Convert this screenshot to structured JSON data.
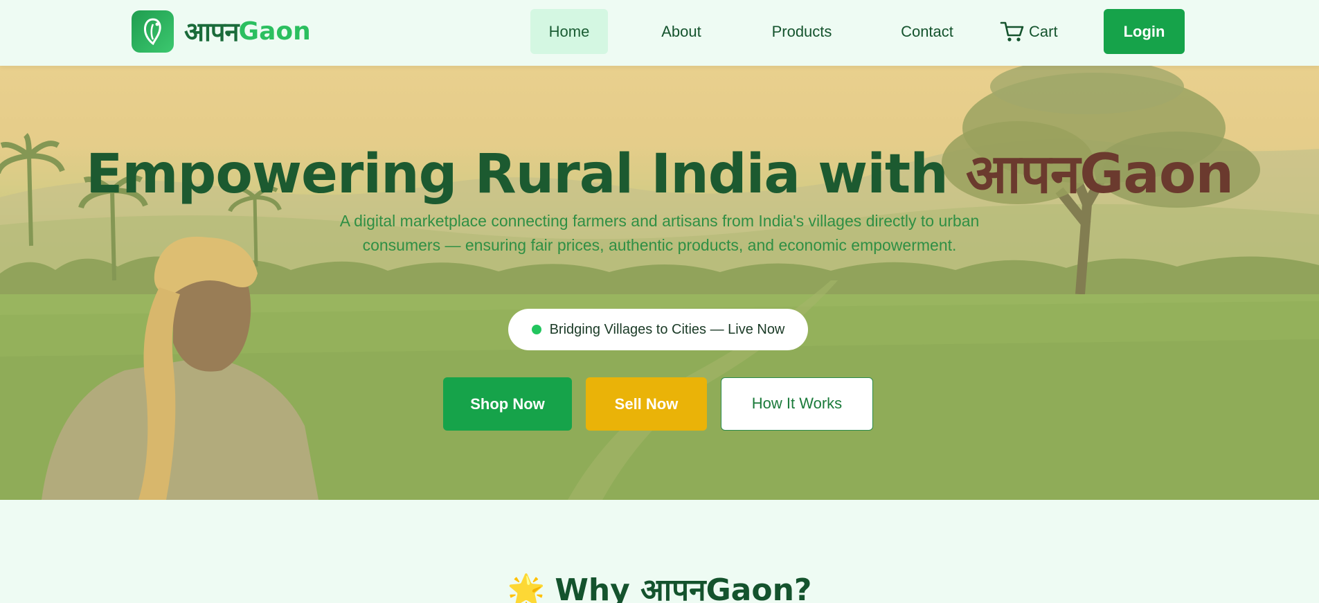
{
  "brand": {
    "hindi": "आपन",
    "latin": "Gaon"
  },
  "nav": {
    "items": [
      "Home",
      "About",
      "Products",
      "Contact"
    ],
    "cart_label": "Cart",
    "login_label": "Login"
  },
  "hero": {
    "title_main": "Empowering Rural India with ",
    "title_accent": "आपनGaon",
    "subtitle": "A digital marketplace connecting farmers and artisans from India's villages directly to urban consumers — ensuring fair prices, authentic products, and economic empowerment.",
    "live_badge": "Bridging Villages to Cities — Live Now",
    "buttons": {
      "shop": "Shop Now",
      "sell": "Sell Now",
      "how": "How It Works"
    }
  },
  "why": {
    "star": "🌟",
    "title": "Why आपनGaon?"
  },
  "colors": {
    "primary_green": "#16a34a",
    "dark_green": "#14532d",
    "accent_yellow": "#eab308",
    "accent_brown": "#6b3a2e",
    "background": "#eefbf3"
  },
  "icons": {
    "logo": "leaf-pin-icon",
    "cart": "cart-icon",
    "live": "live-dot-icon"
  }
}
